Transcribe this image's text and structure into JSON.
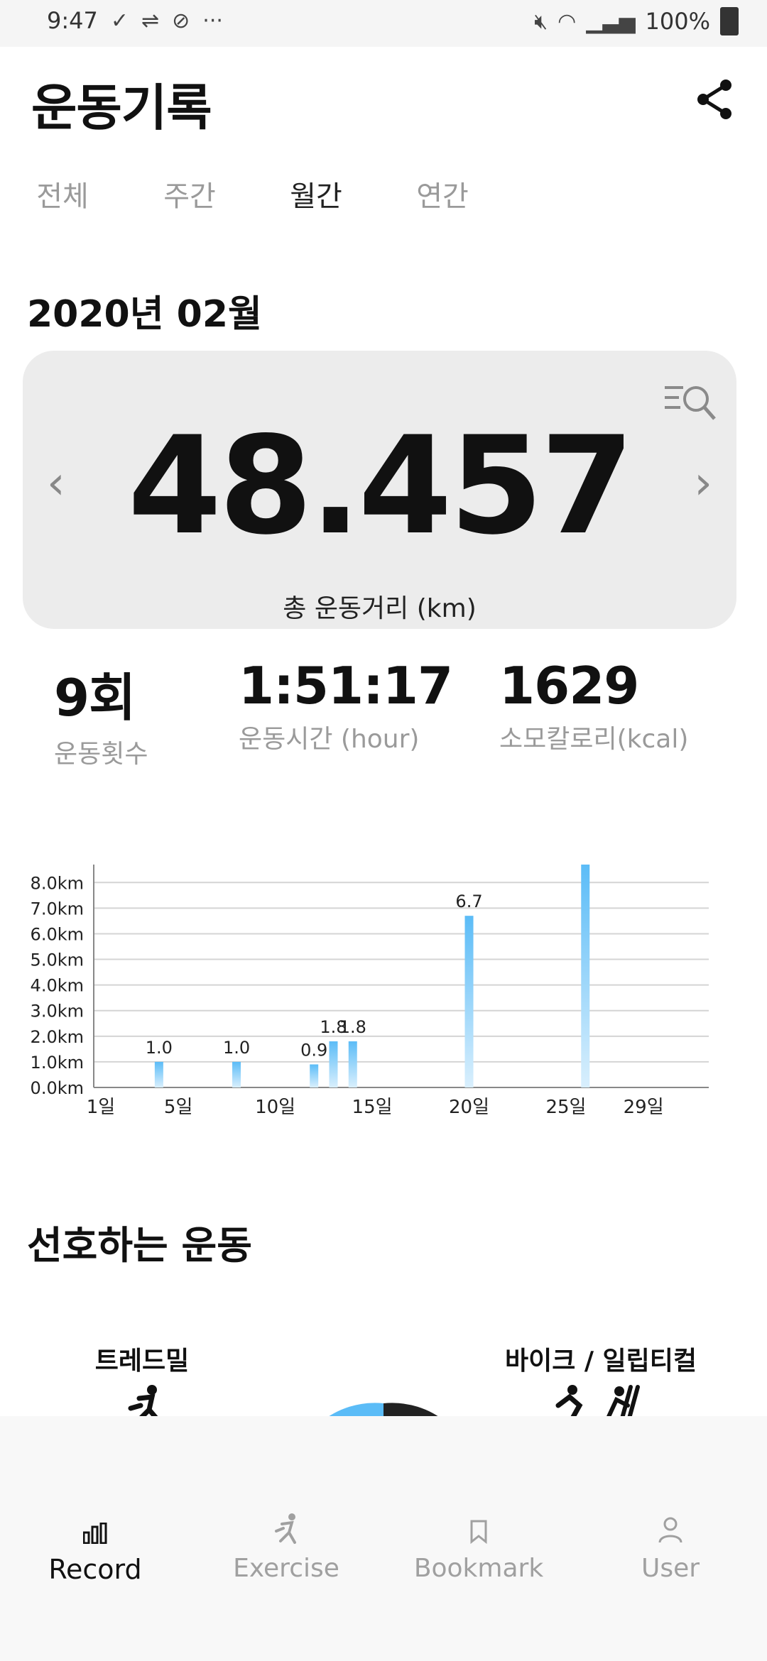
{
  "status_bar": {
    "time": "9:47",
    "icons_left": [
      "check-icon",
      "usb-icon",
      "no-sim-icon",
      "more-icon"
    ],
    "icons_right": [
      "mute-icon",
      "wifi-icon",
      "signal-icon",
      "battery-icon"
    ],
    "battery": "100%"
  },
  "header": {
    "title": "운동기록",
    "share_icon": "share-icon"
  },
  "tabs": [
    {
      "label": "전체",
      "active": false
    },
    {
      "label": "주간",
      "active": false
    },
    {
      "label": "월간",
      "active": true
    },
    {
      "label": "연간",
      "active": false
    }
  ],
  "period": {
    "label": "2020년 02월"
  },
  "summary": {
    "value": "48.457",
    "caption": "총 운동거리 (km)",
    "prev_icon": "chevron-left-icon",
    "next_icon": "chevron-right-icon",
    "filter_icon": "list-search-icon"
  },
  "stats": [
    {
      "value": "9회",
      "label": "운동횟수"
    },
    {
      "value": "1:51:17",
      "label": "운동시간 (hour)"
    },
    {
      "value": "1629",
      "label": "소모칼로리(kcal)"
    }
  ],
  "chart_data": {
    "type": "bar",
    "ylim": [
      0,
      8.7
    ],
    "y_ticks": [
      {
        "value": 0,
        "label": "0.0km"
      },
      {
        "value": 1,
        "label": "1.0km"
      },
      {
        "value": 2,
        "label": "2.0km"
      },
      {
        "value": 3,
        "label": "3.0km"
      },
      {
        "value": 4,
        "label": "4.0km"
      },
      {
        "value": 5,
        "label": "5.0km"
      },
      {
        "value": 6,
        "label": "6.0km"
      },
      {
        "value": 7,
        "label": "7.0km"
      },
      {
        "value": 8,
        "label": "8.0km"
      }
    ],
    "x_range": [
      1,
      32
    ],
    "x_ticks": [
      {
        "day": 1,
        "label": "1일"
      },
      {
        "day": 5,
        "label": "5일"
      },
      {
        "day": 10,
        "label": "10일"
      },
      {
        "day": 15,
        "label": "15일"
      },
      {
        "day": 20,
        "label": "20일"
      },
      {
        "day": 25,
        "label": "25일"
      },
      {
        "day": 29,
        "label": "29일"
      }
    ],
    "bars": [
      {
        "day": 4,
        "value": 1.0,
        "label": "1.0"
      },
      {
        "day": 8,
        "value": 1.0,
        "label": "1.0"
      },
      {
        "day": 12,
        "value": 0.9,
        "label": "0.9"
      },
      {
        "day": 13,
        "value": 1.8,
        "label": "1.8"
      },
      {
        "day": 14,
        "value": 1.8,
        "label": "1.8"
      },
      {
        "day": 20,
        "value": 6.7,
        "label": "6.7"
      },
      {
        "day": 26,
        "value": 8.7,
        "label": ""
      }
    ],
    "grid": true,
    "colors": {
      "bar_top": "#5bbcf7",
      "bar_bottom": "#d9effd",
      "grid": "#d4d4d4"
    }
  },
  "favorites": {
    "title": "선호하는 운동",
    "items": [
      {
        "label": "트레드밀",
        "icon": "running-icon"
      },
      {
        "label": "바이크 / 일립티컬",
        "icon": "bike-elliptical-icon"
      }
    ],
    "colors": {
      "primary": "#5bbcf7",
      "secondary": "#222222"
    }
  },
  "bottom_nav": [
    {
      "label": "Record",
      "icon": "bar-chart-icon",
      "active": true
    },
    {
      "label": "Exercise",
      "icon": "runner-icon",
      "active": false
    },
    {
      "label": "Bookmark",
      "icon": "bookmark-icon",
      "active": false
    },
    {
      "label": "User",
      "icon": "user-icon",
      "active": false
    }
  ]
}
